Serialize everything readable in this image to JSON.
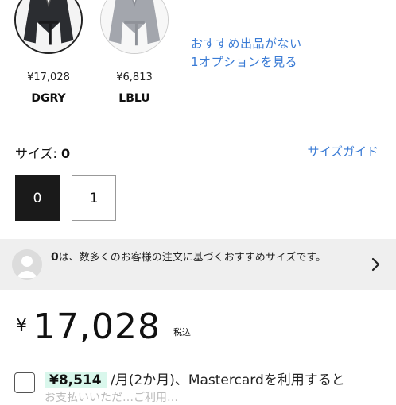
{
  "colors": [
    {
      "price": "¥17,028",
      "name": "DGRY",
      "selected": true
    },
    {
      "price": "¥6,813",
      "name": "LBLU",
      "selected": false
    }
  ],
  "no_recommendation": {
    "line1": "おすすめ出品がない",
    "line2": "1オプションを見る"
  },
  "size": {
    "label": "サイズ:",
    "value": "0",
    "guide": "サイズガイド",
    "options": [
      "0",
      "1"
    ],
    "selected": "0"
  },
  "recommend_banner": {
    "highlight": "0",
    "text": "は、数多くのお客様の注文に基づくおすすめサイズです。"
  },
  "price": {
    "currency": "¥",
    "amount": "17,028",
    "tax_label": "税込"
  },
  "installment": {
    "amount": "¥8,514",
    "text": "/月(2か月)、Mastercardを利用すると",
    "next_line": "お支払いいただ…ご利用…"
  },
  "accent_color": "#3a7bd5"
}
